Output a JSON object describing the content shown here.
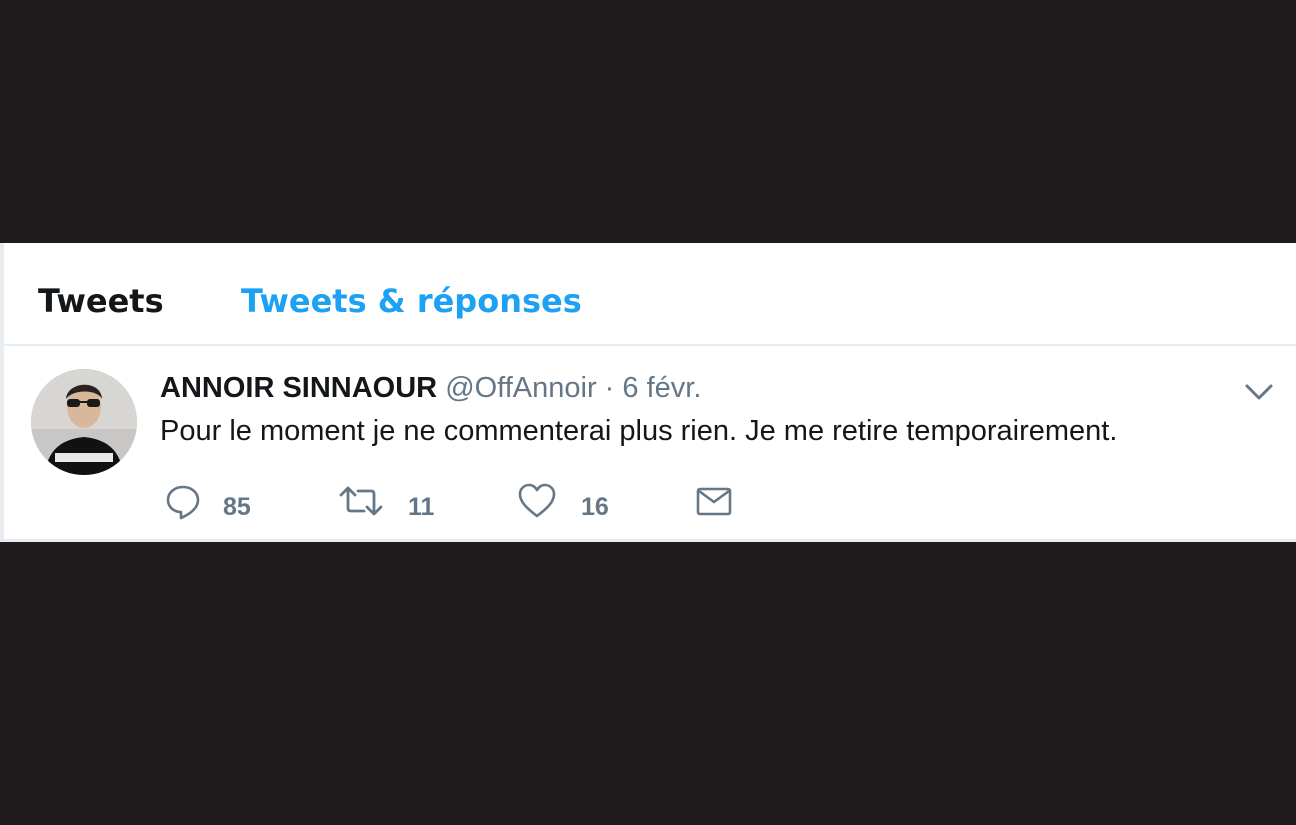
{
  "tabs": [
    {
      "label": "Tweets",
      "active": true
    },
    {
      "label": "Tweets & réponses",
      "active": false
    }
  ],
  "tweet": {
    "avatar_icon": "profile-photo",
    "author_name": "ANNOIR SINNAOUR",
    "handle": "@OffAnnoir",
    "separator": "·",
    "date": "6 févr.",
    "text": "Pour le moment je ne commenterai plus rien. Je me retire temporairement.",
    "menu_icon": "chevron-down-icon",
    "actions": {
      "reply": {
        "icon": "reply-icon",
        "count": "85"
      },
      "retweet": {
        "icon": "retweet-icon",
        "count": "11"
      },
      "like": {
        "icon": "heart-icon",
        "count": "16"
      },
      "dm": {
        "icon": "envelope-icon"
      }
    }
  },
  "colors": {
    "background": "#1f1b1c",
    "card": "#ffffff",
    "accent": "#1da1f2",
    "primary_text": "#14171a",
    "secondary_text": "#657786",
    "border": "#e6ecf0"
  }
}
